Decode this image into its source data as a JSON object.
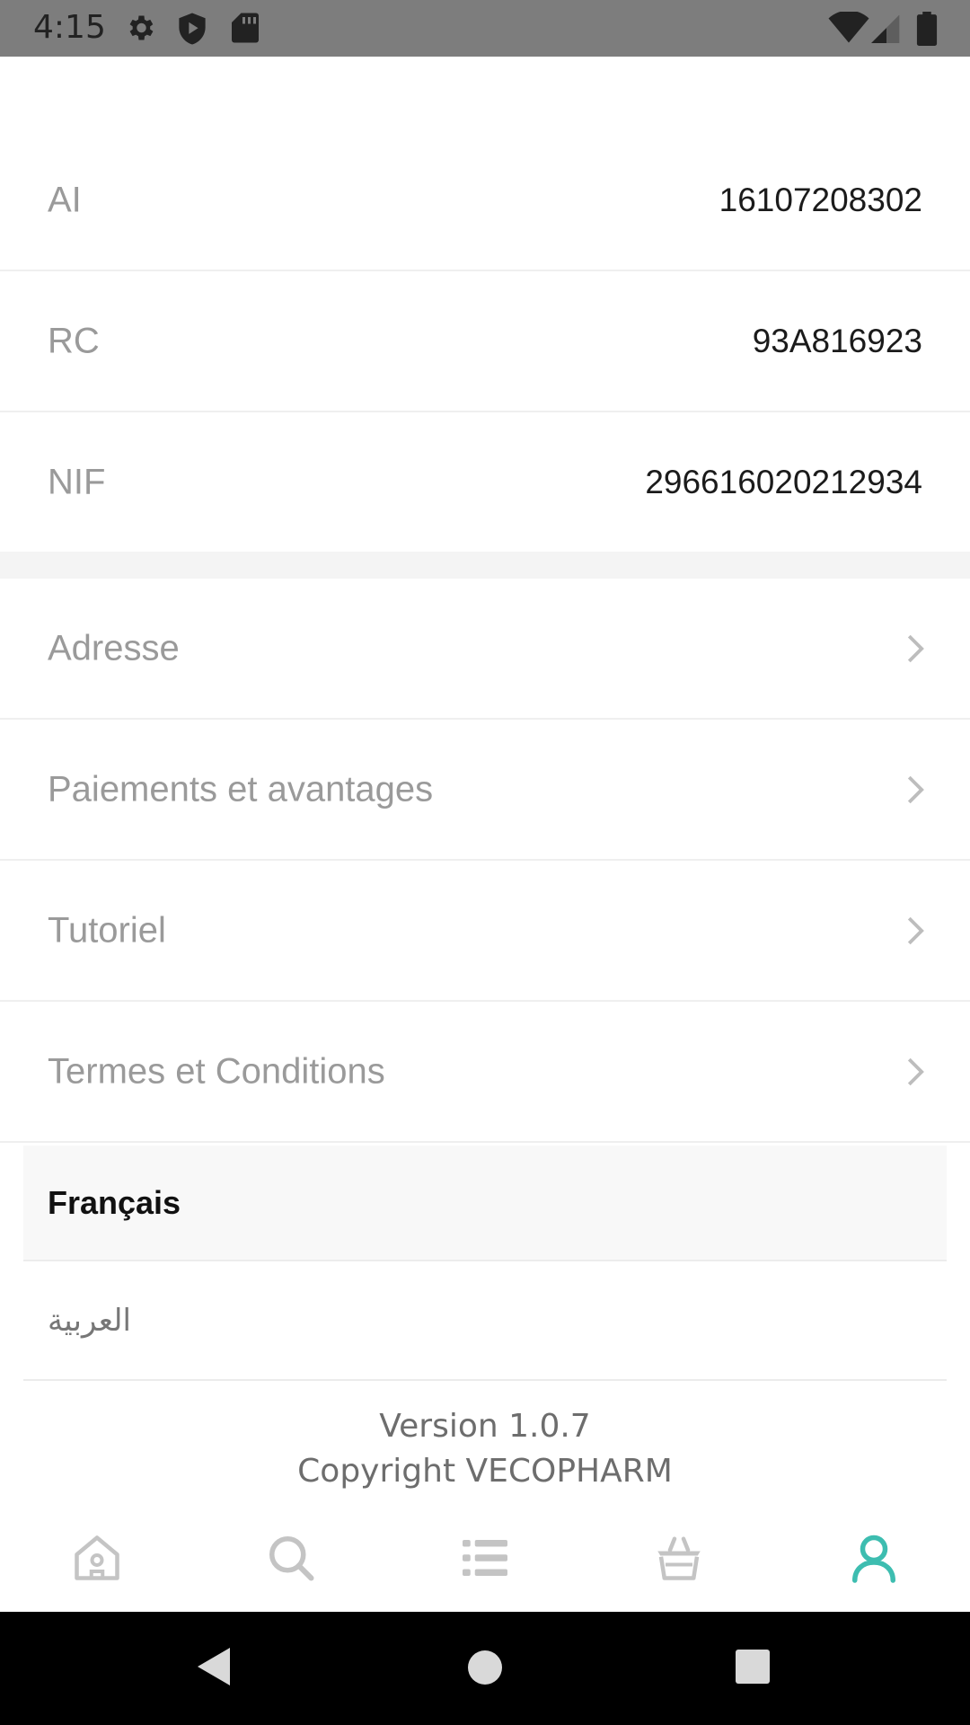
{
  "status_bar": {
    "time": "4:15",
    "icons_left": [
      "gear-icon",
      "shield-play-icon",
      "sd-card-icon"
    ],
    "icons_right": [
      "wifi-icon",
      "signal-icon",
      "battery-icon"
    ]
  },
  "info": [
    {
      "label": "AI",
      "value": "16107208302"
    },
    {
      "label": "RC",
      "value": "93A816923"
    },
    {
      "label": "NIF",
      "value": "296616020212934"
    }
  ],
  "menu": [
    {
      "label": "Adresse"
    },
    {
      "label": "Paiements et avantages"
    },
    {
      "label": "Tutoriel"
    },
    {
      "label": "Termes et Conditions"
    }
  ],
  "language": {
    "selected": "Français",
    "options": [
      "Français",
      "العربية"
    ]
  },
  "footer": {
    "version": "Version 1.0.7",
    "copyright": "Copyright VECOPHARM"
  },
  "bottom_nav": {
    "items": [
      "home-icon",
      "search-icon",
      "list-icon",
      "basket-icon",
      "profile-icon"
    ],
    "active": "profile-icon",
    "active_color": "#3dbdb0",
    "inactive_color": "#c4c4c4"
  }
}
